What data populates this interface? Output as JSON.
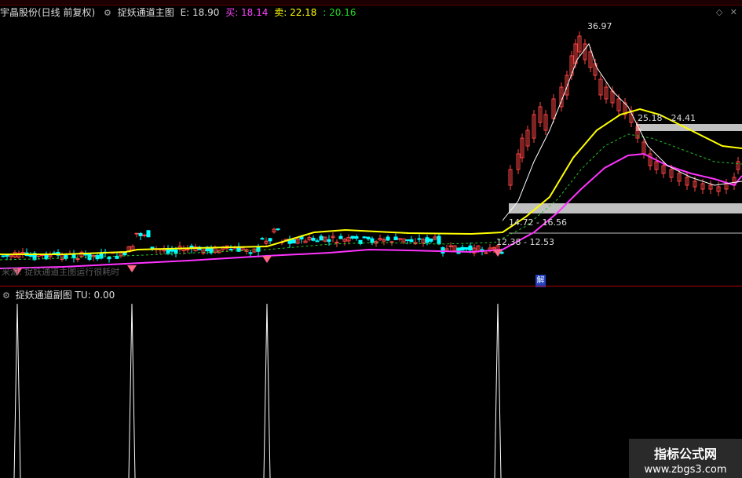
{
  "main": {
    "stock_name": "宇晶股份(日线 前复权)",
    "indicator_name": "捉妖通道主图",
    "e_label": "E: 18.90",
    "buy_label": "买: 18.14",
    "sell_label": "卖: 22.18",
    "extra_value": ": 20.16",
    "note": "来源: 捉妖通道主图运行很耗时",
    "badge": "解",
    "annotations": {
      "high": "36.97",
      "upper_band": "25.18 - 24.41",
      "mid_band": "14.72 - 16.56",
      "low_band": "12.38 - 12.53"
    },
    "colors": {
      "yellow_line": "#ffff00",
      "magenta_line": "#ff33ff",
      "green_dash": "#22cc22",
      "up_candle": "#ff4444",
      "down_candle": "#00ffff",
      "band": "#c0c0c0"
    }
  },
  "sub": {
    "indicator_name": "捉妖通道副图",
    "tu_label": "TU: 0.00"
  },
  "watermark": {
    "title": "指标公式网",
    "url": "www.zbgs3.com"
  }
}
